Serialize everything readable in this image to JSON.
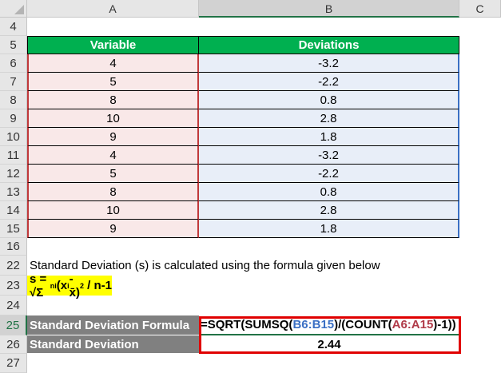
{
  "columns": [
    "A",
    "B",
    "C"
  ],
  "rows": {
    "r4": "4",
    "r5": "5",
    "r16": "16",
    "r22": "22",
    "r23": "23",
    "r24": "24",
    "r25": "25",
    "r26": "26",
    "r27": "27"
  },
  "table": {
    "headers": [
      "Variable",
      "Deviations"
    ],
    "rows": [
      {
        "n": "6",
        "v": "4",
        "d": "-3.2"
      },
      {
        "n": "7",
        "v": "5",
        "d": "-2.2"
      },
      {
        "n": "8",
        "v": "8",
        "d": "0.8"
      },
      {
        "n": "9",
        "v": "10",
        "d": "2.8"
      },
      {
        "n": "10",
        "v": "9",
        "d": "1.8"
      },
      {
        "n": "11",
        "v": "4",
        "d": "-3.2"
      },
      {
        "n": "12",
        "v": "5",
        "d": "-2.2"
      },
      {
        "n": "13",
        "v": "8",
        "d": "0.8"
      },
      {
        "n": "14",
        "v": "10",
        "d": "2.8"
      },
      {
        "n": "15",
        "v": "9",
        "d": "1.8"
      }
    ]
  },
  "note": "Standard Deviation (s)  is calculated using the formula given below",
  "formula_text": {
    "a": "s = √Σ",
    "n": "n",
    "i": "i",
    "b": "(x",
    "c": "-x̄)",
    "sq": "2",
    "d": " / n-1"
  },
  "result": {
    "formula_label": "Standard Deviation Formula",
    "f1": "=SQRT(SUMSQ(",
    "f2": "B6:B15",
    "f3": ")/(COUNT(",
    "f4": "A6:A15",
    "f5": ")-1))",
    "sd_label": "Standard Deviation",
    "sd_value": "2.44"
  }
}
